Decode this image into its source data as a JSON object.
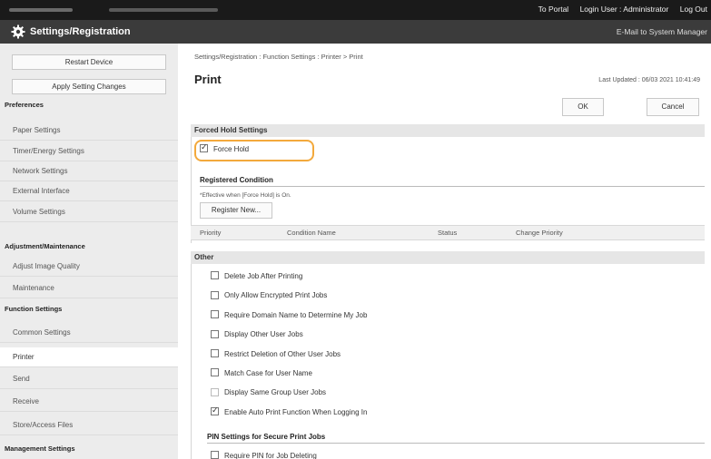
{
  "topbar": {
    "portal": "To Portal",
    "login_user": "Login User :  Administrator",
    "logout": "Log Out"
  },
  "header": {
    "title": "Settings/Registration",
    "mail": "E-Mail to System Manager"
  },
  "sidebar": {
    "restart": "Restart Device",
    "apply": "Apply Setting Changes",
    "groups": {
      "preferences": "Preferences",
      "adjustment": "Adjustment/Maintenance",
      "function": "Function Settings",
      "management": "Management Settings"
    },
    "items": {
      "paper": "Paper Settings",
      "timer": "Timer/Energy Settings",
      "network": "Network Settings",
      "external": "External Interface",
      "volume": "Volume Settings",
      "image_quality": "Adjust Image Quality",
      "maintenance": "Maintenance",
      "common": "Common Settings",
      "printer": "Printer",
      "send": "Send",
      "receive": "Receive",
      "store": "Store/Access Files"
    }
  },
  "main": {
    "breadcrumb": "Settings/Registration : Function Settings : Printer > Print",
    "title": "Print",
    "last_updated": "Last Updated : 06/03 2021 10:41:49",
    "ok": "OK",
    "cancel": "Cancel",
    "forced_hold": {
      "heading": "Forced Hold Settings",
      "force_hold": "Force Hold"
    },
    "registered": {
      "heading": "Registered Condition",
      "note": "*Effective when [Force Hold] is On.",
      "register_new": "Register New...",
      "columns": [
        "Priority",
        "Condition Name",
        "Status",
        "Change Priority"
      ]
    },
    "other": {
      "heading": "Other",
      "options": [
        {
          "label": "Delete Job After Printing",
          "checked": false,
          "disabled": false
        },
        {
          "label": "Only Allow Encrypted Print Jobs",
          "checked": false,
          "disabled": false
        },
        {
          "label": "Require Domain Name to Determine My Job",
          "checked": false,
          "disabled": false
        },
        {
          "label": "Display Other User Jobs",
          "checked": false,
          "disabled": false
        },
        {
          "label": "Restrict Deletion of Other User Jobs",
          "checked": false,
          "disabled": false
        },
        {
          "label": "Match Case for User Name",
          "checked": false,
          "disabled": false
        },
        {
          "label": "Display Same Group User Jobs",
          "checked": false,
          "disabled": true
        },
        {
          "label": "Enable Auto Print Function When Logging In",
          "checked": true,
          "disabled": false
        }
      ]
    },
    "pin": {
      "heading": "PIN Settings for Secure Print Jobs",
      "require_pin": "Require PIN for Job Deleting"
    }
  }
}
